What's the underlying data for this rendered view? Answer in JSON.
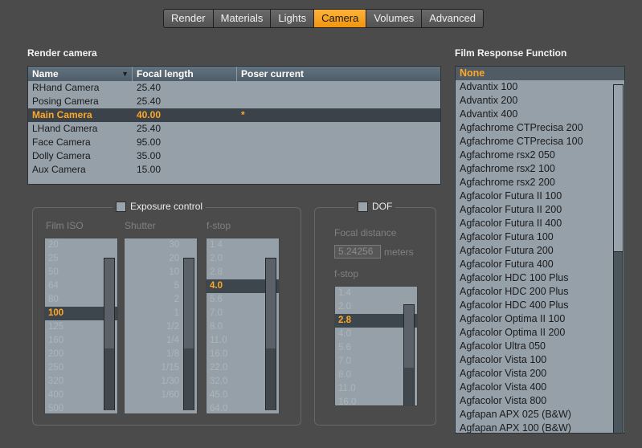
{
  "tabs": [
    "Render",
    "Materials",
    "Lights",
    "Camera",
    "Volumes",
    "Advanced"
  ],
  "active_tab": "Camera",
  "render_camera": {
    "title": "Render camera",
    "columns": [
      "Name",
      "Focal length",
      "Poser current"
    ],
    "rows": [
      {
        "name": "RHand Camera",
        "focal": "25.40",
        "current": ""
      },
      {
        "name": "Posing Camera",
        "focal": "25.40",
        "current": ""
      },
      {
        "name": "Main Camera",
        "focal": "40.00",
        "current": "*"
      },
      {
        "name": "LHand Camera",
        "focal": "25.40",
        "current": ""
      },
      {
        "name": "Face Camera",
        "focal": "95.00",
        "current": ""
      },
      {
        "name": "Dolly Camera",
        "focal": "35.00",
        "current": ""
      },
      {
        "name": "Aux Camera",
        "focal": "15.00",
        "current": ""
      }
    ],
    "selected_index": 2
  },
  "exposure": {
    "label": "Exposure control",
    "checked": false,
    "film_iso_label": "Film ISO",
    "shutter_label": "Shutter",
    "fstop_label": "f-stop",
    "film_iso": [
      "20",
      "25",
      "50",
      "64",
      "80",
      "100",
      "125",
      "160",
      "200",
      "250",
      "320",
      "400",
      "500"
    ],
    "film_iso_selected": 5,
    "shutter": [
      "30",
      "20",
      "10",
      "5",
      "2",
      "1",
      "1/2",
      "1/4",
      "1/8",
      "1/15",
      "1/30",
      "1/60"
    ],
    "fstop": [
      "1.4",
      "2.0",
      "2.8",
      "4.0",
      "5.6",
      "7.0",
      "8.0",
      "11.0",
      "16.0",
      "22.0",
      "32.0",
      "45.0",
      "64.0"
    ],
    "fstop_selected": 3
  },
  "dof": {
    "label": "DOF",
    "checked": false,
    "focal_distance_label": "Focal distance",
    "focal_distance_value": "5.24256",
    "focal_distance_unit": "meters",
    "fstop_label": "f-stop",
    "fstop": [
      "1.4",
      "2.0",
      "2.8",
      "4.0",
      "5.6",
      "7.0",
      "8.0",
      "11.0",
      "16.0"
    ],
    "fstop_selected": 2
  },
  "film_response": {
    "title": "Film Response Function",
    "items": [
      "None",
      "Advantix 100",
      "Advantix 200",
      "Advantix 400",
      "Agfachrome CTPrecisa 200",
      "Agfachrome CTPrecisa 100",
      "Agfachrome rsx2 050",
      "Agfachrome rsx2 100",
      "Agfachrome rsx2 200",
      "Agfacolor Futura II 100",
      "Agfacolor Futura II 200",
      "Agfacolor Futura II 400",
      "Agfacolor Futura 100",
      "Agfacolor Futura 200",
      "Agfacolor Futura 400",
      "Agfacolor HDC 100 Plus",
      "Agfacolor HDC 200 Plus",
      "Agfacolor HDC 400 Plus",
      "Agfacolor Optima II 100",
      "Agfacolor Optima II 200",
      "Agfacolor Ultra 050",
      "Agfacolor Vista 100",
      "Agfacolor Vista 200",
      "Agfacolor Vista 400",
      "Agfacolor Vista 800",
      "Agfapan APX 025 (B&W)",
      "Agfapan APX 100 (B&W)"
    ],
    "selected_index": 0
  },
  "colors": {
    "accent": "#ffa826",
    "list_bg": "#95a0a9",
    "panel_bg": "#4b4b4b"
  }
}
